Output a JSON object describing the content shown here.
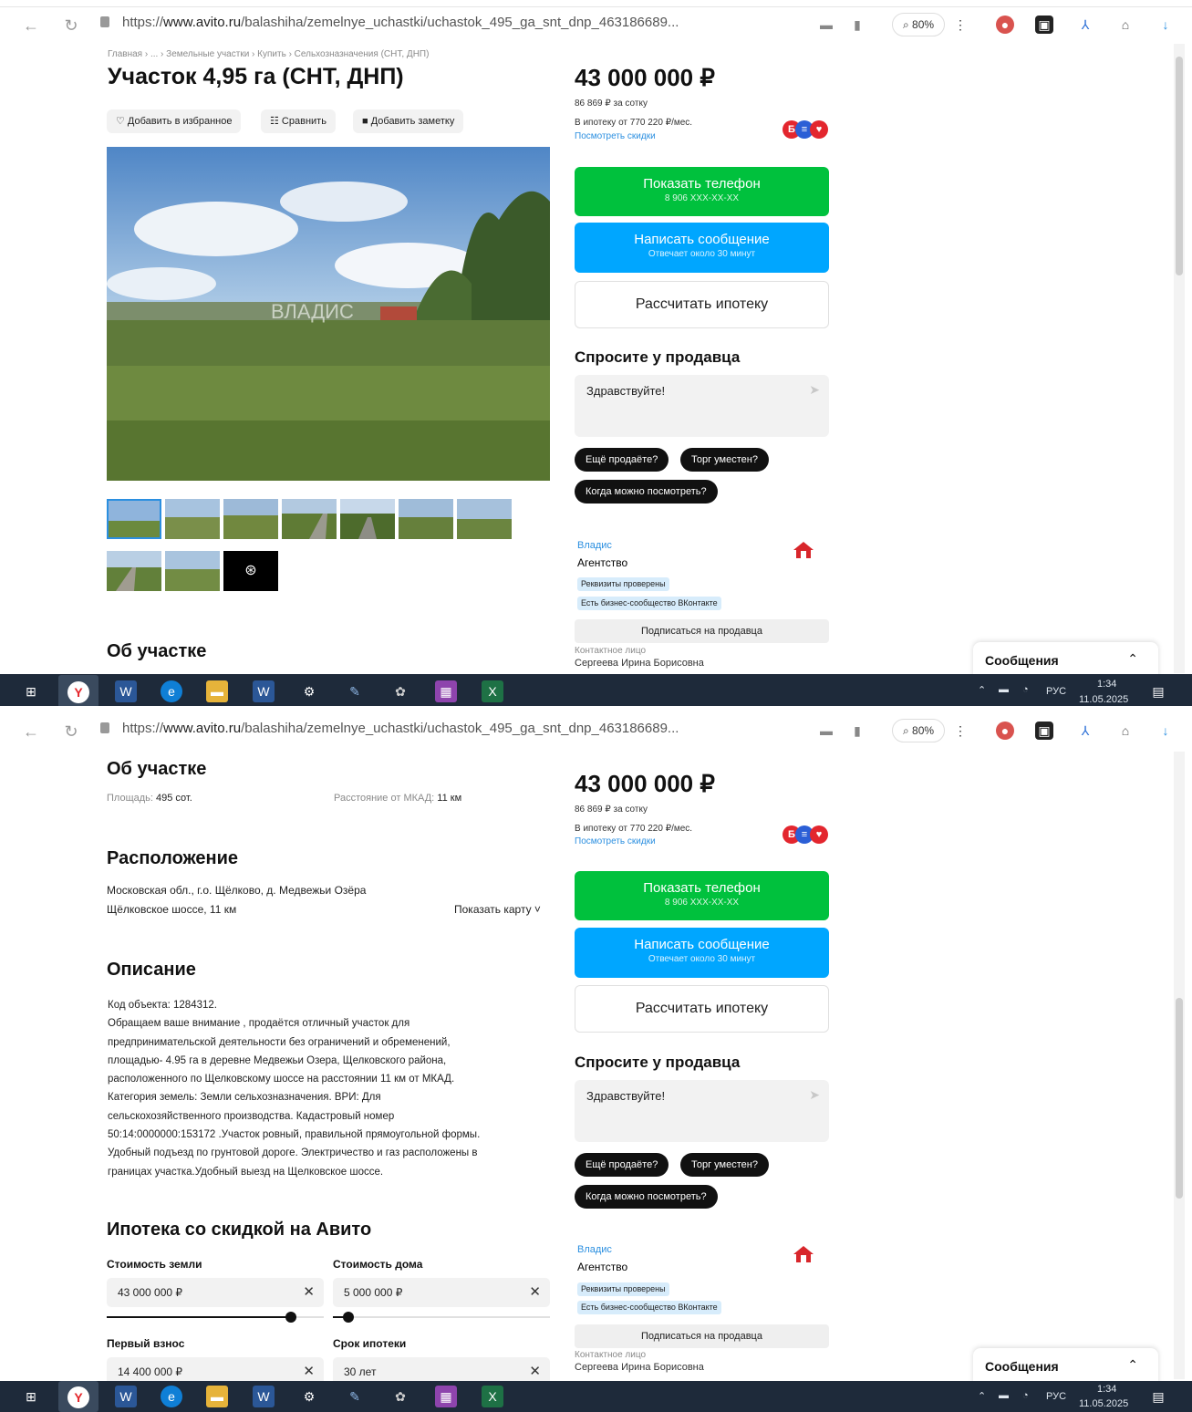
{
  "browser": {
    "url_prefix": "https://",
    "url_domain": "www.avito.ru",
    "url_path": "/balashiha/zemelnye_uchastki/uchastok_495_ga_snt_dnp_463186689...",
    "zoom": "80%"
  },
  "breadcrumbs": "Главная › ... › Земельные участки › Купить › Сельхозназначения (СНТ, ДНП)",
  "listing": {
    "title": "Участок 4,95 га (СНТ, ДНП)",
    "actions": {
      "favorite": "Добавить в избранное",
      "compare": "Сравнить",
      "note": "Добавить заметку"
    },
    "photo_watermark": "ВЛАДИС"
  },
  "sidebar": {
    "price": "43 000 000 ₽",
    "price_per_sotka": "86 869 ₽ за сотку",
    "mortgage_from": "В ипотеку от 770 220 ₽/мес.",
    "discounts_link": "Посмотреть скидки",
    "show_phone": "Показать телефон",
    "phone_mask": "8 906 XXX-XX-XX",
    "write_message": "Написать сообщение",
    "reply_time": "Отвечает около 30 минут",
    "calc_mortgage": "Рассчитать ипотеку",
    "ask_seller": "Спросите у продавца",
    "ask_placeholder": "Здравствуйте!",
    "quick_replies": [
      "Ещё продаёте?",
      "Торг уместен?",
      "Когда можно посмотреть?"
    ],
    "seller_name": "Владис",
    "seller_type": "Агентство",
    "tag_verified": "Реквизиты проверены",
    "tag_vk": "Есть бизнес-сообщество ВКонтакте",
    "subscribe": "Подписаться на продавца",
    "contact_label": "Контактное лицо",
    "contact_name": "Сергеева Ирина Борисовна",
    "logo_text": "ВЛАДИС"
  },
  "messages_widget": "Сообщения",
  "about": {
    "heading": "Об участке",
    "area_label": "Площадь:",
    "area_value": "495 сот.",
    "distance_label": "Расстояние от МКАД:",
    "distance_value": "11 км"
  },
  "location": {
    "heading": "Расположение",
    "address": "Московская обл., г.о. Щёлково, д. Медвежьи Озёра",
    "highway": "Щёлковское шоссе, 11 км",
    "show_map": "Показать карту"
  },
  "description": {
    "heading": "Описание",
    "lines": [
      "Код объекта: 1284312.",
      "Обращаем ваше внимание , продаётся отличный участок для",
      "предпринимательской деятельности без ограничений и обременений,",
      "площадью- 4.95 га в деревне Медвежьи Озера, Щелковского района,",
      "расположенного по Щелковскому шоссе на расстоянии 11 км от МКАД.",
      "Категория земель: Земли сельхозназначения. ВРИ: Для",
      "сельскохозяйственного производства. Кадастровый номер",
      "50:14:0000000:153172 .Участок ровный, правильной прямоугольной формы.",
      "Удобный подъезд по грунтовой дороге. Электричество и газ расположены в",
      "границах участка.Удобный выезд на Щелковское шоссе."
    ]
  },
  "mortgage": {
    "heading": "Ипотека со скидкой на Авито",
    "land_cost_label": "Стоимость земли",
    "land_cost": "43 000 000 ₽",
    "land_slider_level": 0.85,
    "house_cost_label": "Стоимость дома",
    "house_cost": "5 000 000 ₽",
    "house_slider_level": 0.07,
    "down_payment_label": "Первый взнос",
    "down_payment": "14 400 000 ₽",
    "term_label": "Срок ипотеки",
    "term": "30 лет"
  },
  "taskbar": {
    "lang": "РУС",
    "time": "1:34",
    "date": "11.05.2025"
  },
  "colors": {
    "green": "#00c13d",
    "blue": "#00a6ff",
    "taskbar": "#1e2a3a"
  }
}
